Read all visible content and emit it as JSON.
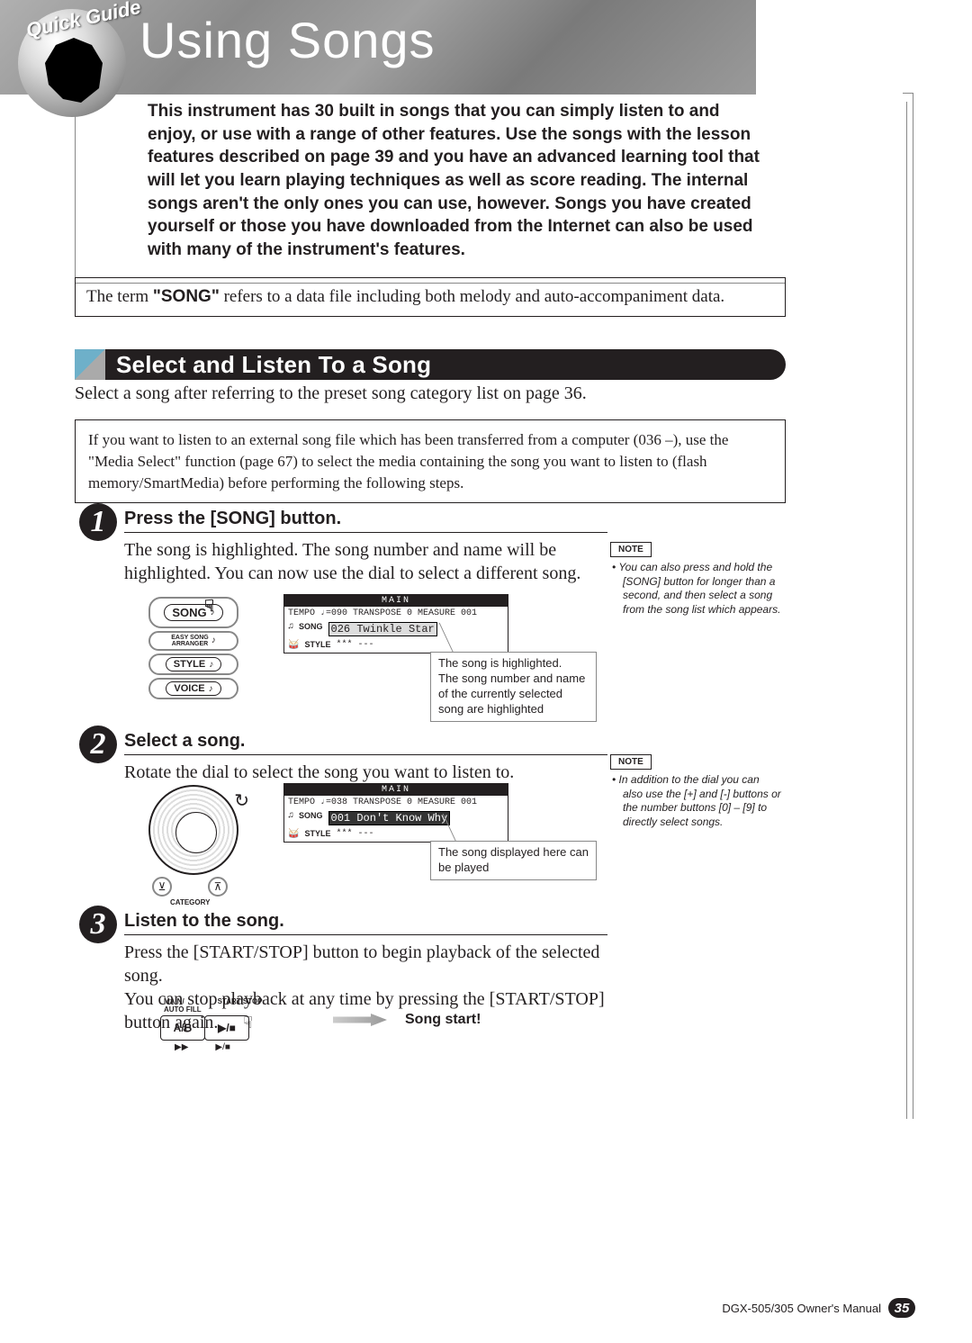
{
  "header": {
    "quick_guide": "Quick Guide",
    "title": "Using Songs"
  },
  "intro": "This instrument has 30 built in songs that you can simply listen to and enjoy, or use with a range of other features. Use the songs with the lesson features described on page 39 and you have an advanced learning tool that will let you learn playing techniques as well as score reading. The internal songs aren't the only ones you can use, however. Songs you have created yourself or those you have downloaded from the Internet can also be used with many of the instrument's features.",
  "term_box": {
    "prefix": "The term ",
    "term": "\"SONG\"",
    "suffix": " refers to a data file including both melody and auto-accompaniment data."
  },
  "section": {
    "title": "Select and Listen To a Song",
    "intro": "Select a song after referring to the preset song category list on page 36.",
    "external_note": "If you want to listen to an external song file which has been transferred from a computer (036 –), use the \"Media Select\" function (page 67) to select the media containing the song you want to listen to (flash memory/SmartMedia) before performing the following steps."
  },
  "steps": {
    "s1": {
      "num": "1",
      "title": "Press the [SONG] button.",
      "body": "The song is highlighted. The song number and name will be highlighted. You can now use the dial to select a different song."
    },
    "s2": {
      "num": "2",
      "title": "Select a song.",
      "body": "Rotate the dial to select the song you want to listen to."
    },
    "s3": {
      "num": "3",
      "title": "Listen to the song.",
      "body": "Press the [START/STOP] button to begin playback of the selected song.\nYou can stop playback at any time by pressing the [START/STOP] button again."
    }
  },
  "panel_buttons": {
    "song": "SONG",
    "easy": "EASY SONG\nARRANGER",
    "style": "STYLE",
    "voice": "VOICE"
  },
  "lcd1": {
    "header": "MAIN",
    "tempo": "TEMPO ♩=090",
    "transpose": "TRANSPOSE 0",
    "measure": "MEASURE 001",
    "song_label": "SONG",
    "song_value": "026 Twinkle Star",
    "style_label": "STYLE",
    "style_value": "*** ---"
  },
  "lcd2": {
    "header": "MAIN",
    "tempo": "TEMPO ♩=038",
    "transpose": "TRANSPOSE 0",
    "measure": "MEASURE 001",
    "song_label": "SONG",
    "song_value": "001 Don't Know Why",
    "style_label": "STYLE",
    "style_value": "*** ---"
  },
  "callouts": {
    "c1": "The song is highlighted.\nThe song number and name of the currently selected song are highlighted",
    "c2": "The song displayed here can be played"
  },
  "notes": {
    "label": "NOTE",
    "n1": "You can also press and hold the [SONG] button for longer than a second, and then select a song from the song list which appears.",
    "n2": "In addition to the dial you can also use the [+] and [-] buttons or the number buttons [0] – [9] to directly select songs."
  },
  "dial": {
    "category": "CATEGORY"
  },
  "control_panel": {
    "label1": "MAIN/\nAUTO FILL",
    "label2": "START/STOP",
    "btn1": "A/B",
    "btn2": "▶/■",
    "sub1": "▶▶",
    "sub2": "▶/■"
  },
  "song_start": "Song start!",
  "footer": {
    "manual": "DGX-505/305  Owner's Manual",
    "page": "35"
  }
}
